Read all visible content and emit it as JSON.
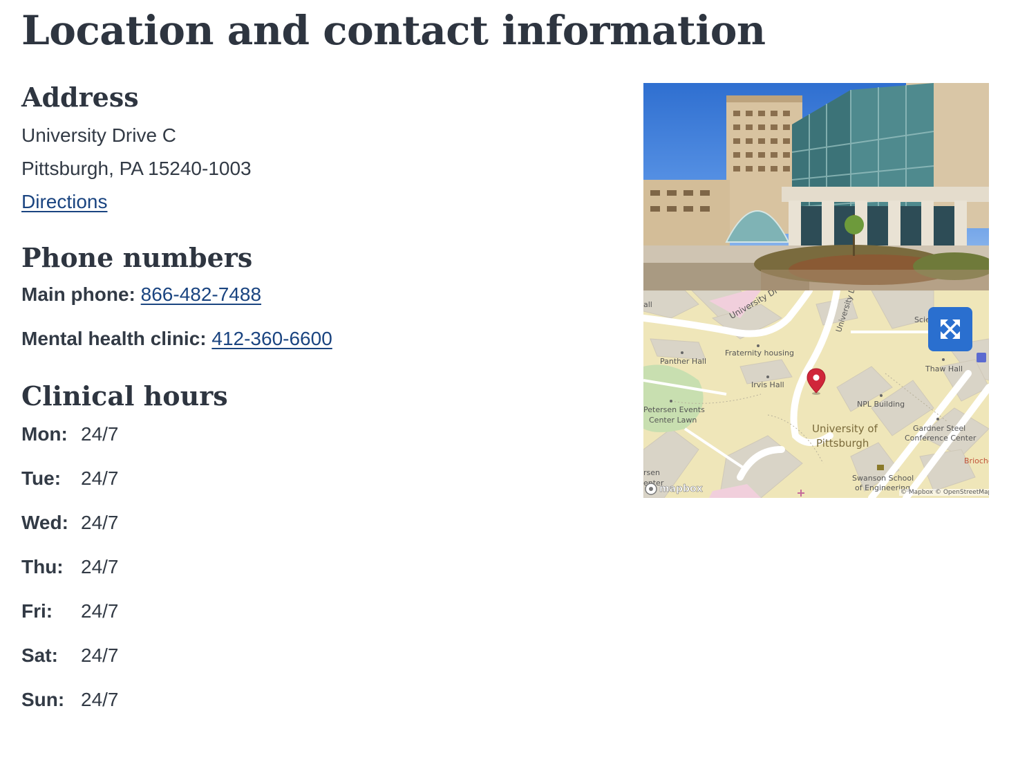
{
  "page": {
    "title": "Location and contact information"
  },
  "address": {
    "heading": "Address",
    "line1": "University Drive C",
    "line2": "Pittsburgh, PA 15240-1003",
    "directions_label": "Directions"
  },
  "phones": {
    "heading": "Phone numbers",
    "items": [
      {
        "label": "Main phone:",
        "number": "866-482-7488"
      },
      {
        "label": "Mental health clinic:",
        "number": "412-360-6600"
      }
    ]
  },
  "hours": {
    "heading": "Clinical hours",
    "rows": [
      {
        "day": "Mon:",
        "value": "24/7"
      },
      {
        "day": "Tue:",
        "value": "24/7"
      },
      {
        "day": "Wed:",
        "value": "24/7"
      },
      {
        "day": "Thu:",
        "value": "24/7"
      },
      {
        "day": "Fri:",
        "value": "24/7"
      },
      {
        "day": "Sat:",
        "value": "24/7"
      },
      {
        "day": "Sun:",
        "value": "24/7"
      }
    ]
  },
  "map": {
    "labels": {
      "university_dr_1": "University Dr",
      "university_dr_2": "University Dr",
      "panther_hall": "Panther Hall",
      "fraternity_housing": "Fraternity housing",
      "irvis_hall": "Irvis Hall",
      "petersen_events": "Petersen Events",
      "center_lawn": "Center Lawn",
      "npl_building": "NPL Building",
      "thaw_hall": "Thaw Hall",
      "univ_of": "University of",
      "pittsburgh": "Pittsburgh",
      "gardner_steel": "Gardner Steel",
      "conference_center": "Conference Center",
      "swanson_school": "Swanson School",
      "of_engineering": "of Engineering",
      "brioche": "Brioche",
      "scie": "Scie",
      "all": "all",
      "rsen": "rsen",
      "enter": "enter",
      "mapbox_logo": "mapbox",
      "attribution": "© Mapbox © OpenStreetMap"
    },
    "expand_icon": "expand-arrows-icon",
    "pin_color": "#d0263a",
    "button_color": "#2a6fcf"
  },
  "colors": {
    "link": "#1a4480",
    "text": "#323a45"
  }
}
